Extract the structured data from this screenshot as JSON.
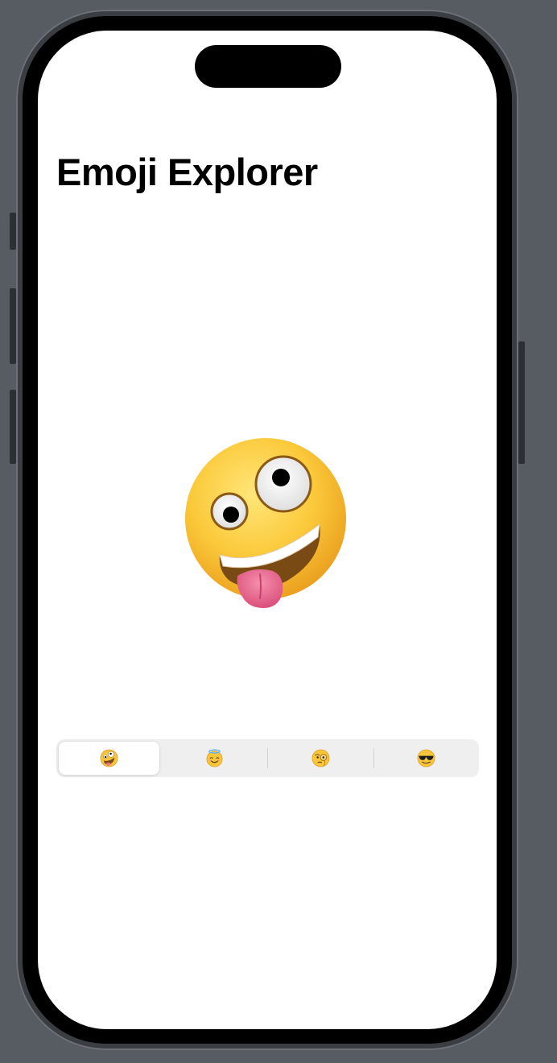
{
  "app": {
    "title": "Emoji Explorer"
  },
  "display": {
    "selected_index": 0,
    "selected_emoji": "🤪",
    "selected_icon": "zany-face-icon"
  },
  "segmented_control": {
    "options": [
      {
        "emoji": "🤪",
        "icon": "zany-face-icon",
        "selected": true
      },
      {
        "emoji": "😇",
        "icon": "halo-smiling-face-icon",
        "selected": false
      },
      {
        "emoji": "🧐",
        "icon": "monocle-face-icon",
        "selected": false
      },
      {
        "emoji": "😎",
        "icon": "sunglasses-face-icon",
        "selected": false
      }
    ]
  },
  "colors": {
    "background": "#575c63",
    "screen": "#ffffff",
    "segmented_track": "#efeff0",
    "segment_selected": "#ffffff",
    "emoji_yellow": "#f9c63a",
    "tongue_pink": "#ec6e93"
  }
}
